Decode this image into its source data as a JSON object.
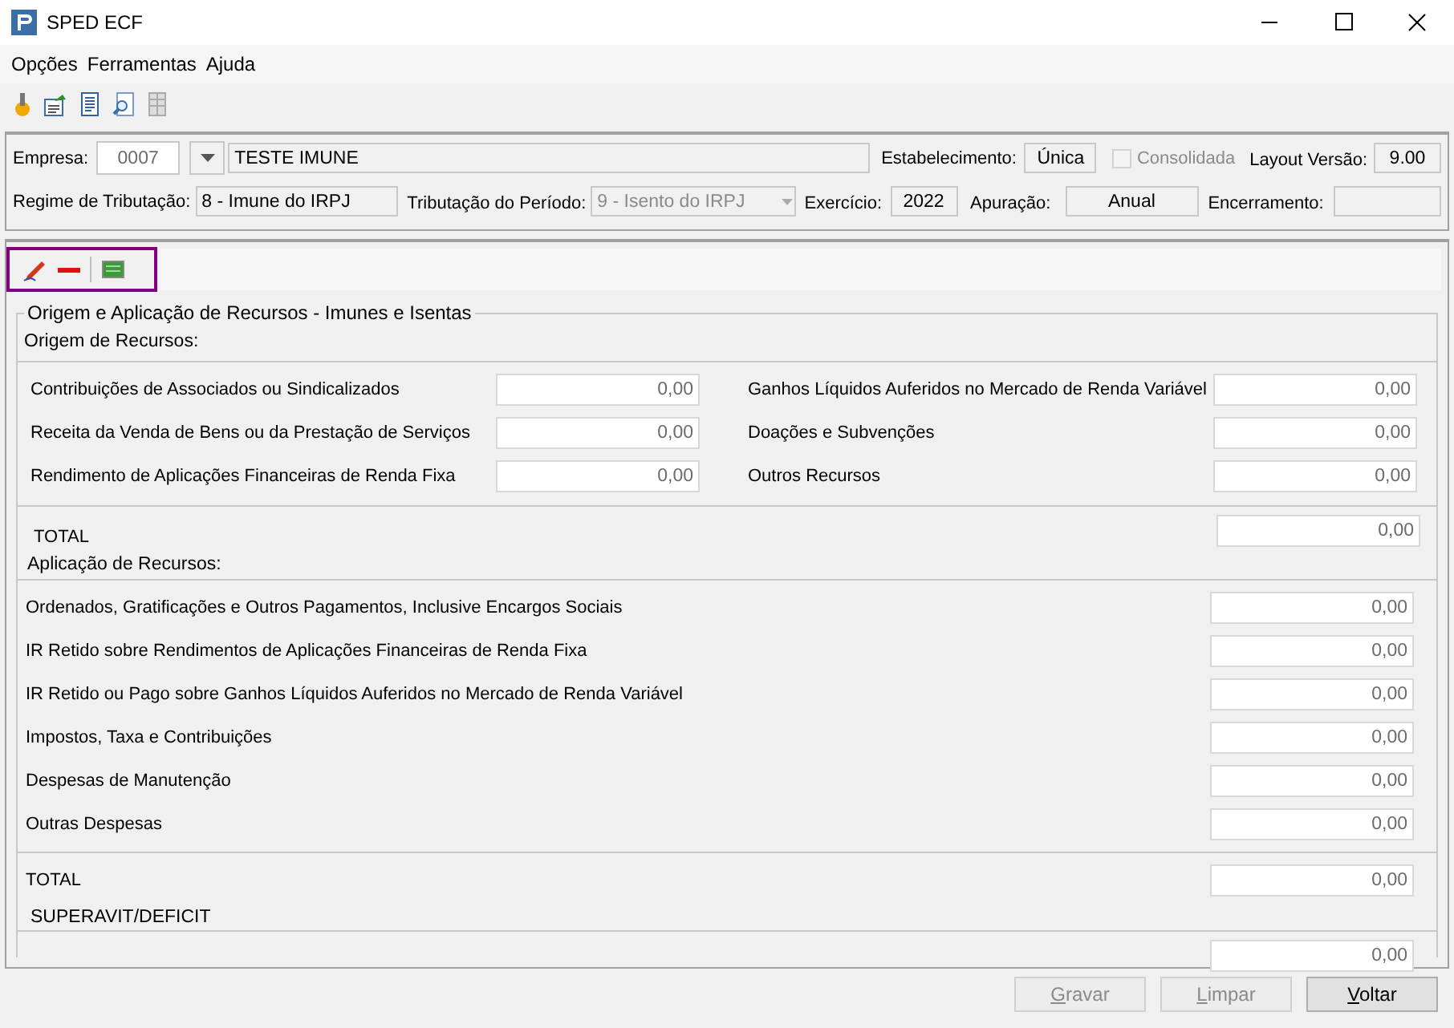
{
  "window": {
    "title": "SPED ECF"
  },
  "menu": [
    "Opções",
    "Ferramentas",
    "Ajuda"
  ],
  "header": {
    "empresa_label": "Empresa:",
    "empresa_code": "0007",
    "empresa_name": "TESTE IMUNE",
    "estabelecimento_label": "Estabelecimento:",
    "estabelecimento": "Única",
    "consolidada": {
      "label": "Consolidada",
      "checked": false,
      "disabled": true
    },
    "layout_label": "Layout Versão:",
    "layout": "9.00",
    "regime_label": "Regime de Tributação:",
    "regime": "8 - Imune do IRPJ",
    "tributacao_label": "Tributação do Período:",
    "tributacao": "9 - Isento do IRPJ",
    "exercicio_label": "Exercício:",
    "exercicio": "2022",
    "apuracao_label": "Apuração:",
    "apuracao": "Anual",
    "encerramento_label": "Encerramento:"
  },
  "group": {
    "title": "Origem e Aplicação de Recursos - Imunes e Isentas",
    "origem": {
      "title": "Origem de Recursos:",
      "left": [
        {
          "label": "Contribuições de Associados ou Sindicalizados",
          "value": "0,00"
        },
        {
          "label": "Receita da Venda de Bens ou da Prestação de Serviços",
          "value": "0,00"
        },
        {
          "label": "Rendimento de Aplicações Financeiras de Renda Fixa",
          "value": "0,00"
        }
      ],
      "right": [
        {
          "label": "Ganhos Líquidos Auferidos no Mercado de Renda Variável",
          "value": "0,00"
        },
        {
          "label": "Doações e Subvenções",
          "value": "0,00"
        },
        {
          "label": "Outros Recursos",
          "value": "0,00"
        }
      ],
      "total": {
        "label": "TOTAL",
        "value": "0,00"
      }
    },
    "aplicacao": {
      "title": "Aplicação de Recursos:",
      "rows": [
        {
          "label": "Ordenados, Gratificações e Outros Pagamentos, Inclusive Encargos Sociais",
          "value": "0,00"
        },
        {
          "label": "IR Retido sobre Rendimentos de Aplicações Financeiras de Renda Fixa",
          "value": "0,00"
        },
        {
          "label": "IR Retido ou Pago sobre Ganhos Líquidos Auferidos no Mercado de Renda Variável",
          "value": "0,00"
        },
        {
          "label": "Impostos, Taxa e Contribuições",
          "value": "0,00"
        },
        {
          "label": "Despesas de Manutenção",
          "value": "0,00"
        },
        {
          "label": "Outras Despesas",
          "value": "0,00"
        }
      ],
      "total": {
        "label": "TOTAL",
        "value": "0,00"
      }
    },
    "superavit": {
      "label": "SUPERAVIT/DEFICIT",
      "value": "0,00"
    }
  },
  "buttons": [
    {
      "label": "Gravar",
      "disabled": true
    },
    {
      "label": "Limpar",
      "disabled": true
    },
    {
      "label": "Voltar",
      "disabled": false
    }
  ]
}
